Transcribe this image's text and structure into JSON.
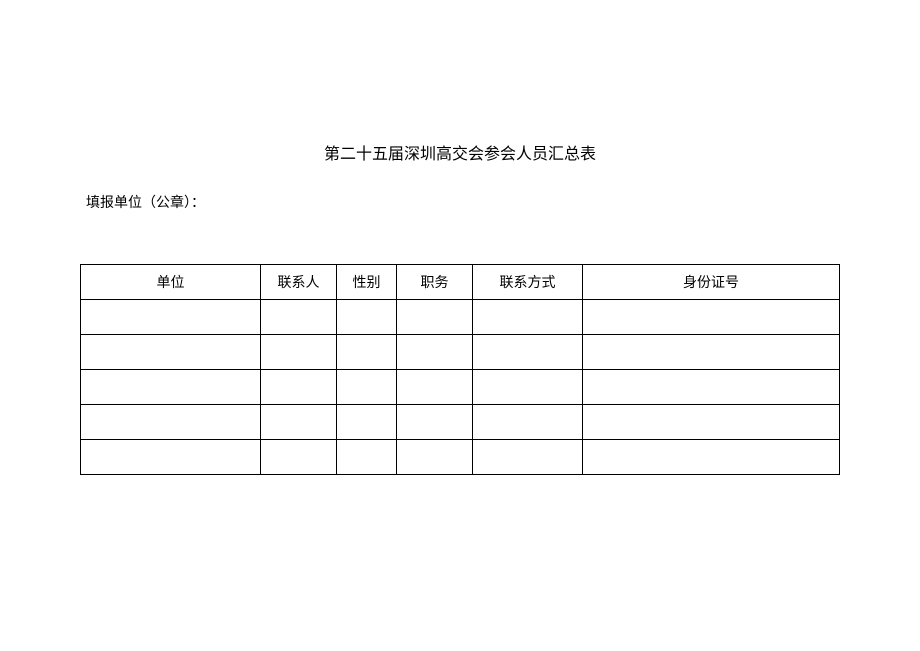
{
  "title": "第二十五届深圳高交会参会人员汇总表",
  "subtitle": "填报单位（公章）：",
  "table": {
    "headers": {
      "unit": "单位",
      "contact": "联系人",
      "gender": "性别",
      "position": "职务",
      "phone": "联系方式",
      "id": "身份证号"
    },
    "rows": [
      {
        "unit": "",
        "contact": "",
        "gender": "",
        "position": "",
        "phone": "",
        "id": ""
      },
      {
        "unit": "",
        "contact": "",
        "gender": "",
        "position": "",
        "phone": "",
        "id": ""
      },
      {
        "unit": "",
        "contact": "",
        "gender": "",
        "position": "",
        "phone": "",
        "id": ""
      },
      {
        "unit": "",
        "contact": "",
        "gender": "",
        "position": "",
        "phone": "",
        "id": ""
      },
      {
        "unit": "",
        "contact": "",
        "gender": "",
        "position": "",
        "phone": "",
        "id": ""
      }
    ]
  }
}
